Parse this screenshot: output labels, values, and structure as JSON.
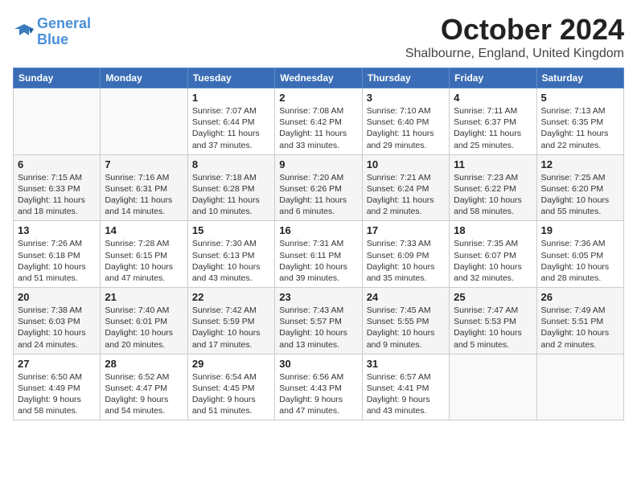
{
  "logo": {
    "line1": "General",
    "line2": "Blue"
  },
  "title": "October 2024",
  "location": "Shalbourne, England, United Kingdom",
  "days_of_week": [
    "Sunday",
    "Monday",
    "Tuesday",
    "Wednesday",
    "Thursday",
    "Friday",
    "Saturday"
  ],
  "weeks": [
    [
      {
        "num": "",
        "detail": ""
      },
      {
        "num": "",
        "detail": ""
      },
      {
        "num": "1",
        "detail": "Sunrise: 7:07 AM\nSunset: 6:44 PM\nDaylight: 11 hours\nand 37 minutes."
      },
      {
        "num": "2",
        "detail": "Sunrise: 7:08 AM\nSunset: 6:42 PM\nDaylight: 11 hours\nand 33 minutes."
      },
      {
        "num": "3",
        "detail": "Sunrise: 7:10 AM\nSunset: 6:40 PM\nDaylight: 11 hours\nand 29 minutes."
      },
      {
        "num": "4",
        "detail": "Sunrise: 7:11 AM\nSunset: 6:37 PM\nDaylight: 11 hours\nand 25 minutes."
      },
      {
        "num": "5",
        "detail": "Sunrise: 7:13 AM\nSunset: 6:35 PM\nDaylight: 11 hours\nand 22 minutes."
      }
    ],
    [
      {
        "num": "6",
        "detail": "Sunrise: 7:15 AM\nSunset: 6:33 PM\nDaylight: 11 hours\nand 18 minutes."
      },
      {
        "num": "7",
        "detail": "Sunrise: 7:16 AM\nSunset: 6:31 PM\nDaylight: 11 hours\nand 14 minutes."
      },
      {
        "num": "8",
        "detail": "Sunrise: 7:18 AM\nSunset: 6:28 PM\nDaylight: 11 hours\nand 10 minutes."
      },
      {
        "num": "9",
        "detail": "Sunrise: 7:20 AM\nSunset: 6:26 PM\nDaylight: 11 hours\nand 6 minutes."
      },
      {
        "num": "10",
        "detail": "Sunrise: 7:21 AM\nSunset: 6:24 PM\nDaylight: 11 hours\nand 2 minutes."
      },
      {
        "num": "11",
        "detail": "Sunrise: 7:23 AM\nSunset: 6:22 PM\nDaylight: 10 hours\nand 58 minutes."
      },
      {
        "num": "12",
        "detail": "Sunrise: 7:25 AM\nSunset: 6:20 PM\nDaylight: 10 hours\nand 55 minutes."
      }
    ],
    [
      {
        "num": "13",
        "detail": "Sunrise: 7:26 AM\nSunset: 6:18 PM\nDaylight: 10 hours\nand 51 minutes."
      },
      {
        "num": "14",
        "detail": "Sunrise: 7:28 AM\nSunset: 6:15 PM\nDaylight: 10 hours\nand 47 minutes."
      },
      {
        "num": "15",
        "detail": "Sunrise: 7:30 AM\nSunset: 6:13 PM\nDaylight: 10 hours\nand 43 minutes."
      },
      {
        "num": "16",
        "detail": "Sunrise: 7:31 AM\nSunset: 6:11 PM\nDaylight: 10 hours\nand 39 minutes."
      },
      {
        "num": "17",
        "detail": "Sunrise: 7:33 AM\nSunset: 6:09 PM\nDaylight: 10 hours\nand 35 minutes."
      },
      {
        "num": "18",
        "detail": "Sunrise: 7:35 AM\nSunset: 6:07 PM\nDaylight: 10 hours\nand 32 minutes."
      },
      {
        "num": "19",
        "detail": "Sunrise: 7:36 AM\nSunset: 6:05 PM\nDaylight: 10 hours\nand 28 minutes."
      }
    ],
    [
      {
        "num": "20",
        "detail": "Sunrise: 7:38 AM\nSunset: 6:03 PM\nDaylight: 10 hours\nand 24 minutes."
      },
      {
        "num": "21",
        "detail": "Sunrise: 7:40 AM\nSunset: 6:01 PM\nDaylight: 10 hours\nand 20 minutes."
      },
      {
        "num": "22",
        "detail": "Sunrise: 7:42 AM\nSunset: 5:59 PM\nDaylight: 10 hours\nand 17 minutes."
      },
      {
        "num": "23",
        "detail": "Sunrise: 7:43 AM\nSunset: 5:57 PM\nDaylight: 10 hours\nand 13 minutes."
      },
      {
        "num": "24",
        "detail": "Sunrise: 7:45 AM\nSunset: 5:55 PM\nDaylight: 10 hours\nand 9 minutes."
      },
      {
        "num": "25",
        "detail": "Sunrise: 7:47 AM\nSunset: 5:53 PM\nDaylight: 10 hours\nand 5 minutes."
      },
      {
        "num": "26",
        "detail": "Sunrise: 7:49 AM\nSunset: 5:51 PM\nDaylight: 10 hours\nand 2 minutes."
      }
    ],
    [
      {
        "num": "27",
        "detail": "Sunrise: 6:50 AM\nSunset: 4:49 PM\nDaylight: 9 hours\nand 58 minutes."
      },
      {
        "num": "28",
        "detail": "Sunrise: 6:52 AM\nSunset: 4:47 PM\nDaylight: 9 hours\nand 54 minutes."
      },
      {
        "num": "29",
        "detail": "Sunrise: 6:54 AM\nSunset: 4:45 PM\nDaylight: 9 hours\nand 51 minutes."
      },
      {
        "num": "30",
        "detail": "Sunrise: 6:56 AM\nSunset: 4:43 PM\nDaylight: 9 hours\nand 47 minutes."
      },
      {
        "num": "31",
        "detail": "Sunrise: 6:57 AM\nSunset: 4:41 PM\nDaylight: 9 hours\nand 43 minutes."
      },
      {
        "num": "",
        "detail": ""
      },
      {
        "num": "",
        "detail": ""
      }
    ]
  ]
}
